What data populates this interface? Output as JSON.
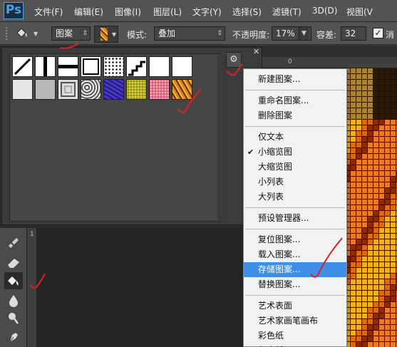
{
  "app": {
    "logo": "Ps"
  },
  "menubar": {
    "items": [
      "文件(F)",
      "编辑(E)",
      "图像(I)",
      "图层(L)",
      "文字(Y)",
      "选择(S)",
      "滤镜(T)",
      "3D(D)",
      "视图(V"
    ]
  },
  "options": {
    "fill_source": "图案",
    "mode_label": "模式:",
    "mode_value": "叠加",
    "opacity_label": "不透明度:",
    "opacity_value": "17%",
    "tolerance_label": "容差:",
    "tolerance_value": "32",
    "antialias_label": "消",
    "antialias_checked": true
  },
  "ruler": {
    "top_origin": "0",
    "left_mark": "1"
  },
  "picker": {
    "gear_icon": "gear-icon",
    "close_icon": "close-icon",
    "patterns": [
      {
        "name": "diagonal-line-pattern",
        "bg": "#ffffff"
      },
      {
        "name": "vertical-bar-pattern",
        "bg": "#ffffff"
      },
      {
        "name": "horizontal-bar-pattern",
        "bg": "#ffffff"
      },
      {
        "name": "black-frame-pattern",
        "bg": "#ffffff"
      },
      {
        "name": "dots-pattern",
        "bg": "#ffffff"
      },
      {
        "name": "stairs-pattern",
        "bg": "#ffffff"
      },
      {
        "name": "white-pattern",
        "bg": "#ffffff"
      },
      {
        "name": "blank-pattern",
        "bg": "#ffffff"
      },
      {
        "name": "light-texture-pattern",
        "bg": "#e6e6e6"
      },
      {
        "name": "gray-texture-pattern",
        "bg": "#b8b8b8"
      },
      {
        "name": "concentric-squares-pattern",
        "bg": "#dcdcdc"
      },
      {
        "name": "marble-pattern",
        "bg": "#9a9a9a"
      },
      {
        "name": "blue-texture-pattern",
        "bg": "#2a1f8c"
      },
      {
        "name": "yellow-texture-pattern",
        "bg": "#c9c12e"
      },
      {
        "name": "pink-texture-pattern",
        "bg": "#e5708c"
      },
      {
        "name": "orange-texture-pattern",
        "bg": "#d9822b"
      }
    ]
  },
  "context_menu": {
    "groups": [
      [
        "新建图案..."
      ],
      [
        "重命名图案...",
        "删除图案"
      ],
      [
        "仅文本",
        "小缩览图",
        "大缩览图",
        "小列表",
        "大列表"
      ],
      [
        "预设管理器..."
      ],
      [
        "复位图案...",
        "载入图案...",
        "存储图案...",
        "替换图案..."
      ],
      [
        "艺术表面",
        "艺术家画笔画布",
        "彩色纸",
        "灰度纸"
      ]
    ],
    "checked_item": "小缩览图",
    "highlighted_item": "存储图案..."
  },
  "colors": {
    "menu_highlight": "#3f8ee8",
    "annotation_red": "#e02020",
    "ps_blue": "#4fa3e0"
  },
  "tools": [
    "healing-brush-icon",
    "eraser-icon",
    "paint-bucket-icon",
    "blur-drop-icon",
    "dodge-icon",
    "pen-icon"
  ]
}
